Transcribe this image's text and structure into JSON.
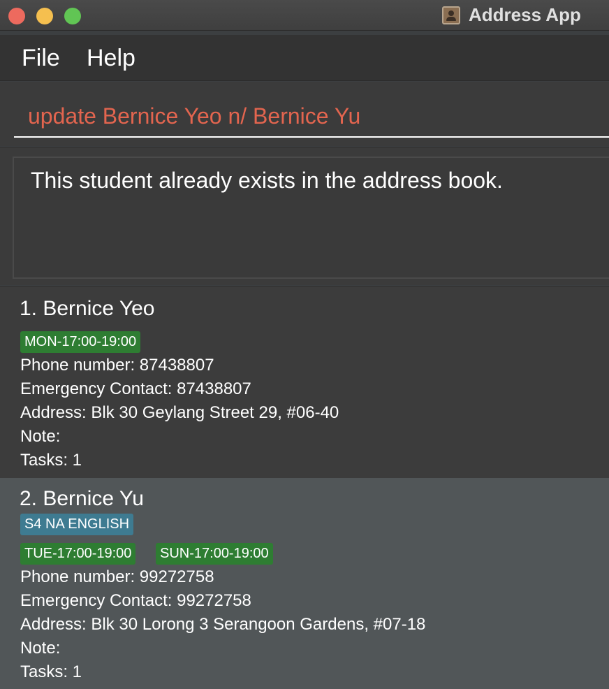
{
  "window": {
    "title": "Address App",
    "traffic_lights": {
      "close": "#ed6a5e",
      "minimize": "#f5bf4f",
      "maximize": "#61c554"
    }
  },
  "menu": {
    "file": "File",
    "help": "Help"
  },
  "command": {
    "value": "update Bernice Yeo n/ Bernice Yu",
    "color": "#e3654f"
  },
  "result": {
    "message": "This student already exists in the address book."
  },
  "persons": [
    {
      "name": "1. Bernice Yeo",
      "subject_tags": [],
      "time_tags": [
        "MON-17:00-19:00"
      ],
      "phone": "Phone number: 87438807",
      "emergency": "Emergency Contact: 87438807",
      "address": "Address: Blk 30 Geylang Street 29, #06-40",
      "note": "Note:",
      "tasks": "Tasks: 1"
    },
    {
      "name": "2. Bernice Yu",
      "subject_tags": [
        "S4 NA ENGLISH"
      ],
      "time_tags": [
        "TUE-17:00-19:00",
        "SUN-17:00-19:00"
      ],
      "phone": "Phone number: 99272758",
      "emergency": "Emergency Contact: 99272758",
      "address": "Address: Blk 30 Lorong 3 Serangoon Gardens, #07-18",
      "note": "Note:",
      "tasks": "Tasks: 1"
    }
  ],
  "colors": {
    "time_tag": "#2e7d32",
    "subject_tag": "#3e7b91",
    "selected_card": "#515658"
  }
}
